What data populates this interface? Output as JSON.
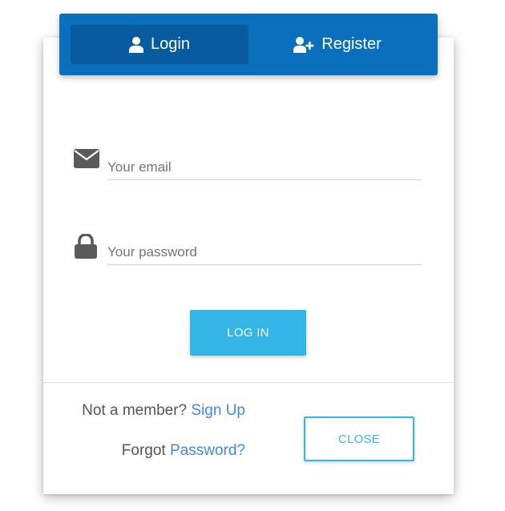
{
  "tabs": [
    {
      "label": "Login",
      "icon": "user-icon",
      "active": true
    },
    {
      "label": "Register",
      "icon": "user-plus-icon",
      "active": false
    }
  ],
  "form": {
    "email": {
      "placeholder": "Your email",
      "value": "",
      "icon": "envelope-icon"
    },
    "password": {
      "placeholder": "Your password",
      "value": "",
      "icon": "lock-icon"
    },
    "submit_label": "LOG IN"
  },
  "footer": {
    "signup_prefix": "Not a member?",
    "signup_link": "Sign Up",
    "forgot_prefix": "Forgot",
    "forgot_link": "Password?",
    "close_label": "CLOSE"
  },
  "colors": {
    "tab_bar": "#0a70bd",
    "tab_active": "#075b9e",
    "primary_button": "#33b5e5",
    "link": "#4285f4",
    "icon": "#5a5a5a"
  }
}
